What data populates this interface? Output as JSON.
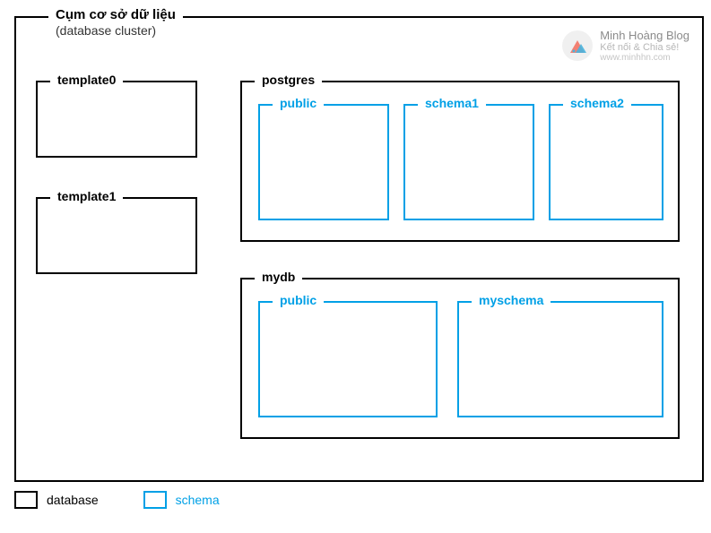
{
  "cluster": {
    "title": "Cụm cơ sở dữ liệu",
    "subtitle": "(database cluster)"
  },
  "watermark": {
    "line1": "Minh Hoàng Blog",
    "line2": "Kết nối & Chia sẻ!",
    "line3": "www.minhhn.com"
  },
  "databases": {
    "template0": {
      "label": "template0"
    },
    "template1": {
      "label": "template1"
    },
    "postgres": {
      "label": "postgres",
      "schemas": [
        "public",
        "schema1",
        "schema2"
      ]
    },
    "mydb": {
      "label": "mydb",
      "schemas": [
        "public",
        "myschema"
      ]
    }
  },
  "legend": {
    "database": "database",
    "schema": "schema"
  },
  "colors": {
    "schema_border": "#00a0e6",
    "db_border": "#000000"
  }
}
